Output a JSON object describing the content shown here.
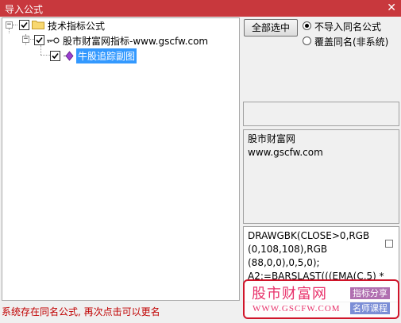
{
  "window": {
    "title": "导入公式",
    "close_glyph": "✕"
  },
  "tree": {
    "root_label": "技术指标公式",
    "child_label": "股市财富网指标-www.gscfw.com",
    "leaf_label": "牛股追踪副图",
    "expander_glyph": "−"
  },
  "controls": {
    "select_all_label": "全部选中",
    "radio_no_import_label": "不导入同名公式",
    "radio_overwrite_label": "覆盖同名(非系统)"
  },
  "info": {
    "line1": "股市财富网",
    "line2": "www.gscfw.com"
  },
  "code": {
    "line1": "DRAWGBK(CLOSE>0,RGB",
    "line2": "(0,108,108),RGB",
    "line3": "(88,0,0),0,5,0);",
    "line4": "A2:=BARSLAST(((EMA(C,5) *"
  },
  "status": {
    "message": "系统存在同名公式, 再次点击可以更名"
  },
  "watermark": {
    "brand": "股市财富网",
    "url": "WWW.GSCFW.COM",
    "tag1": "指标分享",
    "tag2": "名师课程"
  },
  "colors": {
    "titlebar": "#c8383d",
    "selection": "#3399ff",
    "status_text": "#c00000",
    "watermark_pink": "#e8326b"
  }
}
